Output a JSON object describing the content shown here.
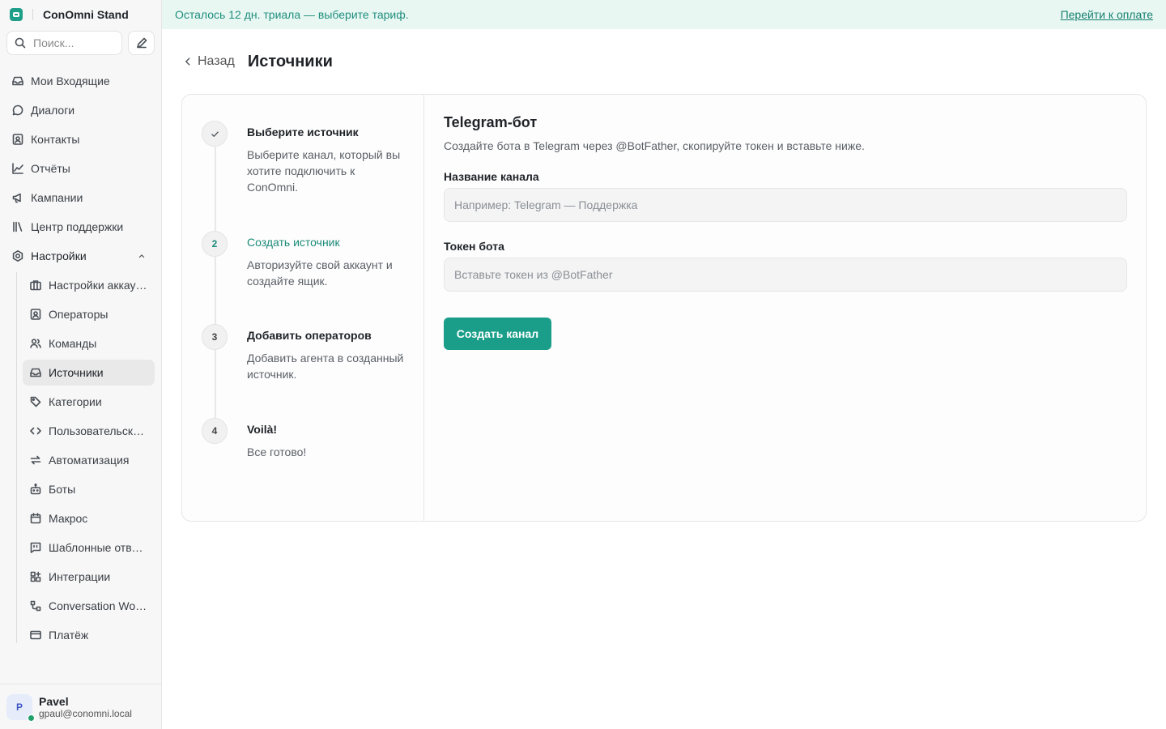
{
  "brand": {
    "name": "ConOmni Stand"
  },
  "search": {
    "placeholder": "Поиск..."
  },
  "nav": [
    {
      "label": "Мои Входящие",
      "icon": "inbox-icon"
    },
    {
      "label": "Диалоги",
      "icon": "chat-icon"
    },
    {
      "label": "Контакты",
      "icon": "contact-icon"
    },
    {
      "label": "Отчёты",
      "icon": "chart-icon"
    },
    {
      "label": "Кампании",
      "icon": "megaphone-icon"
    },
    {
      "label": "Центр поддержки",
      "icon": "library-icon"
    },
    {
      "label": "Настройки",
      "icon": "settings-icon"
    }
  ],
  "settings_sub": [
    {
      "label": "Настройки аккаунта",
      "icon": "briefcase-icon"
    },
    {
      "label": "Операторы",
      "icon": "contact-icon"
    },
    {
      "label": "Команды",
      "icon": "users-icon"
    },
    {
      "label": "Источники",
      "icon": "inbox-icon"
    },
    {
      "label": "Категории",
      "icon": "tag-icon"
    },
    {
      "label": "Пользовательские атрибуты",
      "icon": "code-icon"
    },
    {
      "label": "Автоматизация",
      "icon": "arrows-icon"
    },
    {
      "label": "Боты",
      "icon": "bot-icon"
    },
    {
      "label": "Макрос",
      "icon": "calendar-icon"
    },
    {
      "label": "Шаблонные ответы",
      "icon": "quote-icon"
    },
    {
      "label": "Интеграции",
      "icon": "grid-plus-icon"
    },
    {
      "label": "Conversation Workflows",
      "icon": "workflow-icon"
    },
    {
      "label": "Платёж",
      "icon": "card-icon"
    }
  ],
  "user": {
    "initial": "P",
    "name": "Pavel",
    "email": "gpaul@conomni.local"
  },
  "banner": {
    "text": "Осталось 12 дн. триала — выберите тариф.",
    "link": "Перейти к оплате"
  },
  "header": {
    "back": "Назад",
    "title": "Источники"
  },
  "steps": [
    {
      "marker": "",
      "title": "Выберите источник",
      "desc": "Выберите канал, который вы хотите подключить к ConOmni.",
      "state": "done"
    },
    {
      "marker": "2",
      "title": "Создать источник",
      "desc": "Авторизуйте свой аккаунт и создайте ящик.",
      "state": "current"
    },
    {
      "marker": "3",
      "title": "Добавить операторов",
      "desc": "Добавить агента в созданный источник.",
      "state": "todo"
    },
    {
      "marker": "4",
      "title": "Voilà!",
      "desc": "Все готово!",
      "state": "todo"
    }
  ],
  "form": {
    "title": "Telegram-бот",
    "subtitle": "Создайте бота в Telegram через @BotFather, скопируйте токен и вставьте ниже.",
    "channel_label": "Название канала",
    "channel_placeholder": "Например: Telegram — Поддержка",
    "channel_value": "",
    "token_label": "Токен бота",
    "token_placeholder": "Вставьте токен из @BotFather",
    "token_value": "",
    "submit": "Создать канал"
  },
  "colors": {
    "accent": "#1a9e89",
    "banner_bg": "#e9f7f3",
    "banner_text": "#1f8f7d"
  }
}
